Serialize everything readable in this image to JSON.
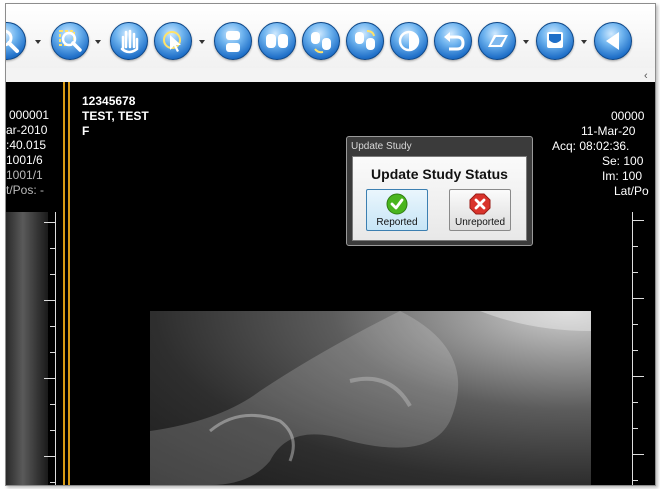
{
  "toolbar": {
    "buttons": [
      {
        "name": "zoom",
        "icon": "magnifier-icon",
        "dropdown": true
      },
      {
        "name": "zoom-region",
        "icon": "zoom-region-icon",
        "dropdown": true
      },
      {
        "name": "pan",
        "icon": "hand-icon",
        "dropdown": false
      },
      {
        "name": "select",
        "icon": "pointer-icon",
        "dropdown": true
      },
      {
        "name": "layout-1",
        "icon": "layout-icon",
        "dropdown": false
      },
      {
        "name": "compare",
        "icon": "compare-icon",
        "dropdown": false
      },
      {
        "name": "sync-1",
        "icon": "sync-icon",
        "dropdown": false
      },
      {
        "name": "sync-2",
        "icon": "sync-alt-icon",
        "dropdown": false
      },
      {
        "name": "invert",
        "icon": "invert-icon",
        "dropdown": false
      },
      {
        "name": "undo",
        "icon": "undo-icon",
        "dropdown": false
      },
      {
        "name": "flip",
        "icon": "flip-icon",
        "dropdown": true
      },
      {
        "name": "window",
        "icon": "window-icon",
        "dropdown": true
      },
      {
        "name": "previous",
        "icon": "previous-icon",
        "dropdown": false
      }
    ],
    "collapse_glyph": "‹"
  },
  "left_pane": {
    "lines": [
      "000001",
      "ar-2010",
      ":40.015",
      "1001/6",
      "1001/1",
      "t/Pos: -"
    ]
  },
  "right_pane": {
    "patient_id": "12345678",
    "patient_name": "TEST, TEST",
    "patient_sex": "F",
    "top_right_lines": [
      "00000",
      "11-Mar-20",
      "Acq: 08:02:36.",
      "Se: 100",
      "Im: 100",
      "Lat/Po"
    ]
  },
  "dialog": {
    "title": "Update Study",
    "heading": "Update Study Status",
    "reported_label": "Reported",
    "unreported_label": "Unreported"
  },
  "colors": {
    "accent_blue": "#1f6fc8",
    "viewport_border": "#d89a14",
    "reported_green": "#49b51e",
    "unreported_red": "#d9332b"
  }
}
